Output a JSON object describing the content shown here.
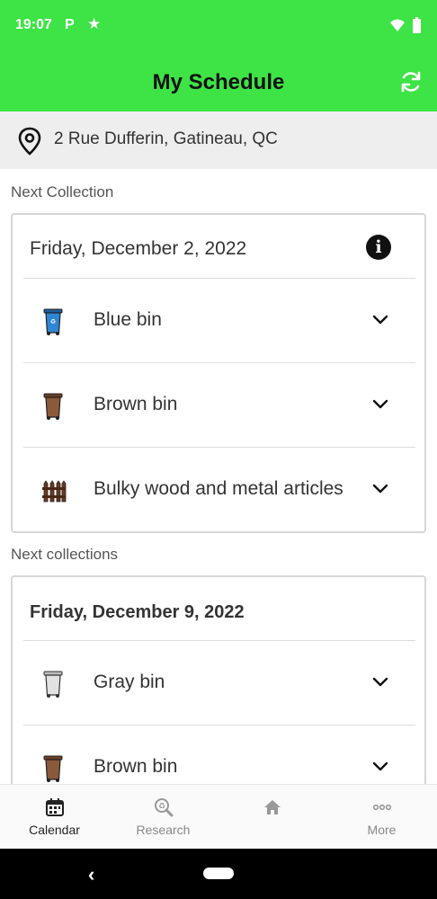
{
  "status_bar": {
    "time": "19:07",
    "app_icon": "P",
    "star_icon": "★"
  },
  "header": {
    "title": "My Schedule",
    "refresh_icon": "refresh-icon"
  },
  "address": {
    "text": "2 Rue Dufferin, Gatineau, QC",
    "icon": "location-pin-icon"
  },
  "next_collection": {
    "label": "Next Collection",
    "date": "Friday, December 2, 2022",
    "items": [
      {
        "label": "Blue bin",
        "icon": "blue-bin-icon",
        "color": "#2f86d4"
      },
      {
        "label": "Brown bin",
        "icon": "brown-bin-icon",
        "color": "#8a5a3a"
      },
      {
        "label": "Bulky wood and metal articles",
        "icon": "fence-icon",
        "color": "#6b3a1e"
      }
    ]
  },
  "next_collections": {
    "label": "Next collections",
    "date": "Friday, December 9, 2022",
    "items": [
      {
        "label": "Gray bin",
        "icon": "gray-bin-icon",
        "color": "#d8d8d8"
      },
      {
        "label": "Brown bin",
        "icon": "brown-bin-icon",
        "color": "#8a5a3a"
      }
    ]
  },
  "bottom_nav": [
    {
      "label": "Calendar",
      "icon": "calendar-icon",
      "active": true
    },
    {
      "label": "Research",
      "icon": "recycle-search-icon",
      "active": false
    },
    {
      "label": "",
      "icon": "home-icon",
      "active": false
    },
    {
      "label": "More",
      "icon": "more-dots-icon",
      "active": false
    }
  ],
  "colors": {
    "accent": "#3ee346",
    "address_bg": "#eeeeee"
  }
}
